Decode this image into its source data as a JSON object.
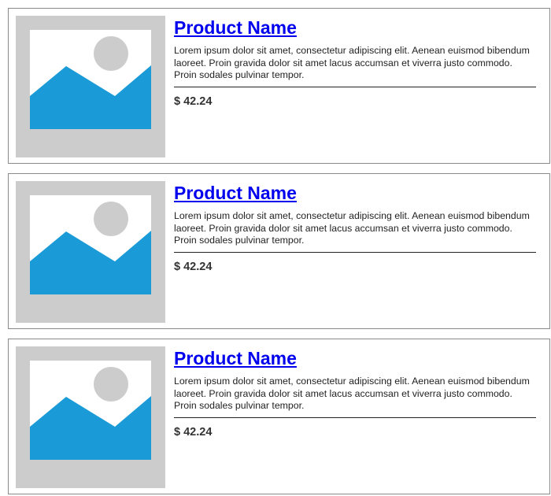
{
  "colors": {
    "placeholder_frame": "#cccccc",
    "placeholder_sky": "#ffffff",
    "placeholder_sun": "#cccccc",
    "placeholder_mountain": "#1a9bd7",
    "link": "#0000ee",
    "card_border": "#8a8a8a"
  },
  "products": [
    {
      "image_icon": "image-placeholder-icon",
      "name": "Product Name",
      "description": "Lorem ipsum dolor sit amet, consectetur adipiscing elit. Aenean euismod bibendum laoreet. Proin gravida dolor sit amet lacus accumsan et viverra justo commodo. Proin sodales pulvinar tempor.",
      "price": "$ 42.24"
    },
    {
      "image_icon": "image-placeholder-icon",
      "name": "Product Name",
      "description": "Lorem ipsum dolor sit amet, consectetur adipiscing elit. Aenean euismod bibendum laoreet. Proin gravida dolor sit amet lacus accumsan et viverra justo commodo. Proin sodales pulvinar tempor.",
      "price": "$ 42.24"
    },
    {
      "image_icon": "image-placeholder-icon",
      "name": "Product Name",
      "description": "Lorem ipsum dolor sit amet, consectetur adipiscing elit. Aenean euismod bibendum laoreet. Proin gravida dolor sit amet lacus accumsan et viverra justo commodo. Proin sodales pulvinar tempor.",
      "price": "$ 42.24"
    }
  ]
}
